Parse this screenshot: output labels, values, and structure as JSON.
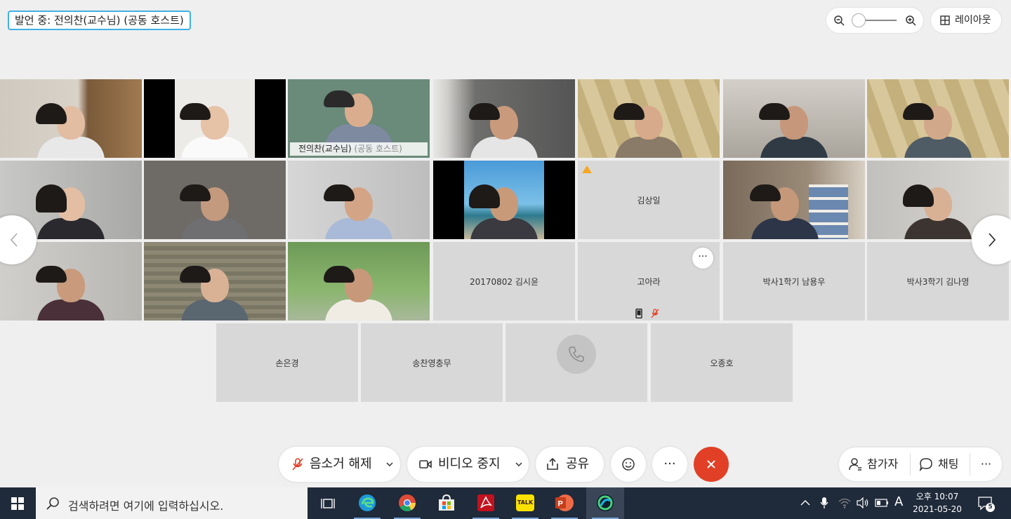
{
  "speaking_banner": "발언 중: 전의찬(교수님) (공동 호스트)",
  "layout_button": "레이아웃",
  "zoom_level": 0.1,
  "participants": {
    "active_speaker_name": "전의찬(교수님)",
    "active_speaker_role": "(공동 호스트)",
    "kim_sangil": "김상일",
    "kim_siyun": "20170802 김시윤",
    "go_ara": "고아라",
    "nam_yongwoo": "박사1학기 남용우",
    "kim_nayoung": "박사3학기 김나영",
    "son_eungyeong": "손은경",
    "song_chanyoung": "송찬영충무",
    "oh_jongho": "오종호"
  },
  "toolbar": {
    "unmute": "음소거 해제",
    "stop_video": "비디오 중지",
    "share": "공유",
    "more": "···",
    "participants": "참가자",
    "chat": "채팅",
    "right_more": "···"
  },
  "taskbar": {
    "search_placeholder": "검색하려면 여기에 입력하십시오.",
    "ime": "A",
    "time": "오후 10:07",
    "date": "2021-05-20",
    "notification_count": "5",
    "kakao_label": "TALK"
  },
  "colors": {
    "accent": "#3fb0e6",
    "end_call": "#e24026",
    "mute_red": "#e24026",
    "taskbar": "#1f2a3a"
  }
}
